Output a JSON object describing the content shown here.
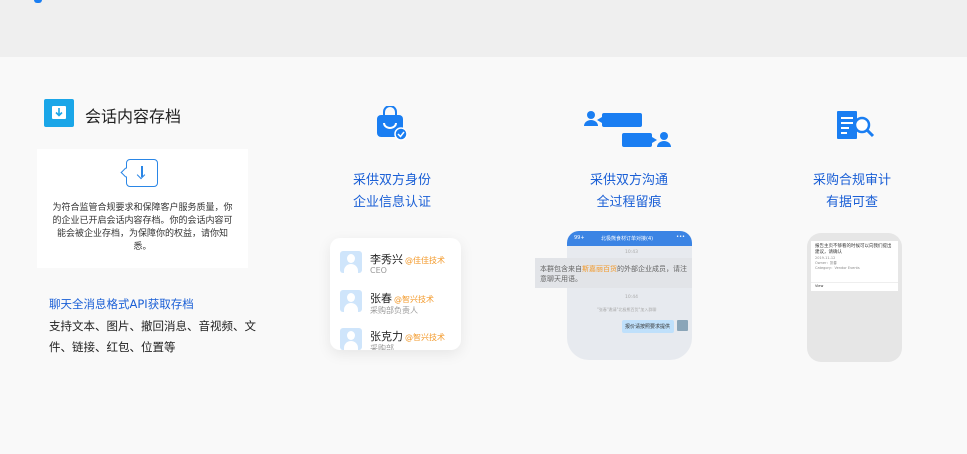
{
  "section": {
    "title": "会话内容存档",
    "notice_text": "为符合监管合规要求和保障客户服务质量，你的企业已开启会话内容存档。你的会话内容可能会被企业存档，为保障你的权益，请你知悉。",
    "feature_title": "聊天全消息格式API获取存档",
    "feature_desc": "支持文本、图片、撤回消息、音视频、文件、链接、红包、位置等"
  },
  "columns": [
    {
      "line1": "采供双方身份",
      "line2": "企业信息认证",
      "icon": "shopping-bag-check-icon"
    },
    {
      "line1": "采供双方沟通",
      "line2": "全过程留痕",
      "icon": "chat-bubbles-icon"
    },
    {
      "line1": "采购合规审计",
      "line2": "有据可查",
      "icon": "document-search-icon"
    }
  ],
  "contacts": [
    {
      "name": "李秀兴",
      "company": "@佳佳技术",
      "role": "CEO"
    },
    {
      "name": "张春",
      "company": "@智兴技术",
      "role": "采购部负责人"
    },
    {
      "name": "张克力",
      "company": "@智兴技术",
      "role": "采购部..."
    }
  ],
  "chat": {
    "title": "北极熊食材订单对接(4)",
    "back": "99+",
    "banner_pre": "本群包含来自",
    "banner_highlight": "斯嘉丽百货",
    "banner_post": "的外部企业成员，请注意聊天用语。",
    "time1": "10:43",
    "time2": "10:44",
    "sys_msg": "\"张春\"邀请\"北极熊百货\"加入群聊",
    "bubble": "报价请按照要求提供"
  },
  "audit": {
    "line1": "报告主页不够看的时候可以向我们提出建议，请确认",
    "line2": "2019-11-12",
    "line3": "Owner：张春",
    "line4": "Category：Vendor Events",
    "more": "View"
  },
  "colors": {
    "accent": "#1a5fd6",
    "icon_blue": "#1a7ef2",
    "company_orange": "#f39a2b"
  }
}
